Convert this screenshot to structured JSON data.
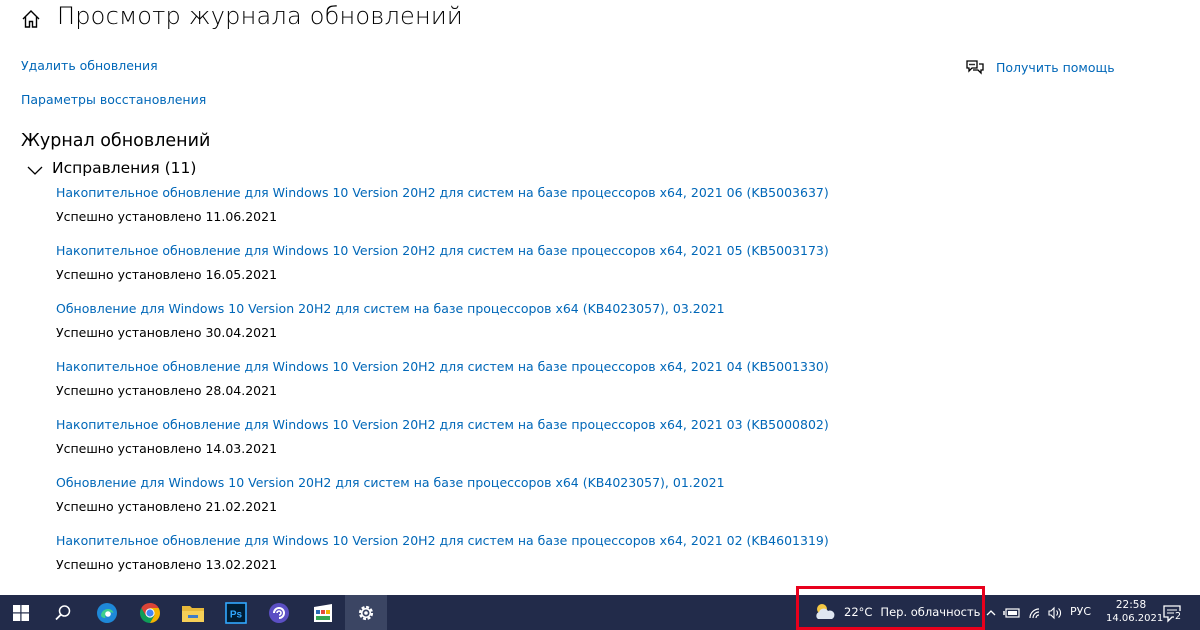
{
  "header": {
    "title": "Просмотр журнала обновлений"
  },
  "links": {
    "uninstall": "Удалить обновления",
    "recovery": "Параметры восстановления"
  },
  "help": {
    "label": "Получить помощь"
  },
  "history": {
    "title": "Журнал обновлений",
    "group_label": "Исправления (11)",
    "items": [
      {
        "name": "Накопительное обновление для Windows 10 Version 20H2 для систем на базе процессоров x64, 2021 06 (KB5003637)",
        "status": "Успешно установлено 11.06.2021"
      },
      {
        "name": "Накопительное обновление для Windows 10 Version 20H2 для систем на базе процессоров x64, 2021 05 (KB5003173)",
        "status": "Успешно установлено 16.05.2021"
      },
      {
        "name": "Обновление для Windows 10 Version 20H2 для систем на базе процессоров x64 (KB4023057), 03.2021",
        "status": "Успешно установлено 30.04.2021"
      },
      {
        "name": "Накопительное обновление для Windows 10 Version 20H2 для систем на базе процессоров x64, 2021 04 (KB5001330)",
        "status": "Успешно установлено 28.04.2021"
      },
      {
        "name": "Накопительное обновление для Windows 10 Version 20H2 для систем на базе процессоров x64, 2021 03 (KB5000802)",
        "status": "Успешно установлено 14.03.2021"
      },
      {
        "name": "Обновление для Windows 10 Version 20H2 для систем на базе процессоров x64 (KB4023057), 01.2021",
        "status": "Успешно установлено 21.02.2021"
      },
      {
        "name": "Накопительное обновление для Windows 10 Version 20H2 для систем на базе процессоров x64, 2021 02 (KB4601319)",
        "status": "Успешно установлено 13.02.2021"
      }
    ]
  },
  "taskbar": {
    "apps": [
      "windows-start-icon",
      "search-icon",
      "edge-icon",
      "chrome-icon",
      "file-explorer-icon",
      "photoshop-icon",
      "browser-app-icon",
      "video-editor-icon",
      "settings-gear-icon"
    ],
    "photoshop_label": "Ps",
    "weather": {
      "temp": "22°C",
      "desc": "Пер. облачность"
    },
    "language": "РУС",
    "time": "22:58",
    "date": "14.06.2021",
    "notification_count": "2"
  },
  "colors": {
    "link": "#0067b8",
    "taskbar": "#222b4a",
    "highlight_box": "#e8001c"
  }
}
